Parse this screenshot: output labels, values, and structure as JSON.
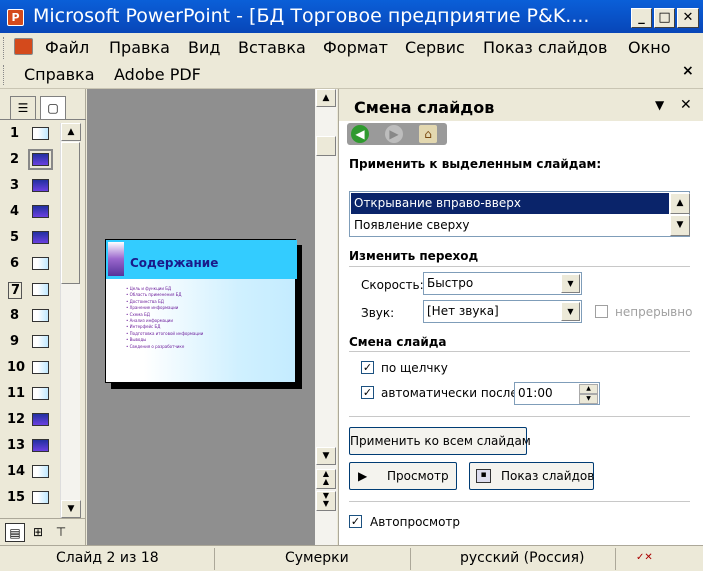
{
  "window": {
    "title": "Microsoft PowerPoint - [БД Торговое предприятие P&K....",
    "icon_name": "powerpoint-icon",
    "buttons": {
      "minimize": "_",
      "maximize": "□",
      "close": "✕"
    }
  },
  "menu": {
    "row1": [
      "Файл",
      "Правка",
      "Вид",
      "Вставка",
      "Формат",
      "Сервис",
      "Показ слайдов",
      "Окно"
    ],
    "row2": [
      "Справка",
      "Adobe PDF"
    ],
    "close_glyph": "×"
  },
  "left_pane": {
    "tabs": [
      {
        "icon": "outline-tab-icon",
        "glyph": "☰"
      },
      {
        "icon": "slides-tab-icon",
        "glyph": "▢"
      }
    ],
    "slide_numbers": [
      "1",
      "2",
      "3",
      "4",
      "5",
      "6",
      "7",
      "8",
      "9",
      "10",
      "11",
      "12",
      "13",
      "14",
      "15"
    ],
    "selected_slide": "2"
  },
  "slide": {
    "title": "Содержание",
    "bullets": [
      "Цель и функции БД",
      "Область применения БД",
      "Достоинства БД",
      "Хранение информации",
      "Схема БД",
      "Анализ информации",
      "Интерфейс БД",
      "Подготовка итоговой информации",
      "Выводы",
      "Сведения о разработчике"
    ]
  },
  "task_pane": {
    "title": "Смена слайдов",
    "dropdown_glyph": "▼",
    "close_glyph": "✕",
    "apply_to_label": "Применить к выделенным слайдам:",
    "transitions": [
      "Открывание вправо-вверх",
      "Появление сверху"
    ],
    "selected_transition": "Открывание вправо-вверх",
    "modify_section": "Изменить переход",
    "speed_label": "Скорость:",
    "speed_value": "Быстро",
    "sound_label": "Звук:",
    "sound_value": "[Нет звука]",
    "loop_label": "непрерывно",
    "advance_section": "Смена слайда",
    "on_click_label": "по щелчку",
    "on_click_checked": true,
    "auto_after_label": "автоматически после",
    "auto_after_checked": true,
    "auto_after_value": "01:00",
    "apply_all_button": "Применить ко всем слайдам",
    "preview_button": "Просмотр",
    "slideshow_button": "Показ слайдов",
    "autopreview_label": "Автопросмотр",
    "autopreview_checked": true,
    "check_glyph": "✓"
  },
  "status_bar": {
    "slide_info": "Слайд 2 из 18",
    "design": "Сумерки",
    "language": "русский (Россия)"
  }
}
